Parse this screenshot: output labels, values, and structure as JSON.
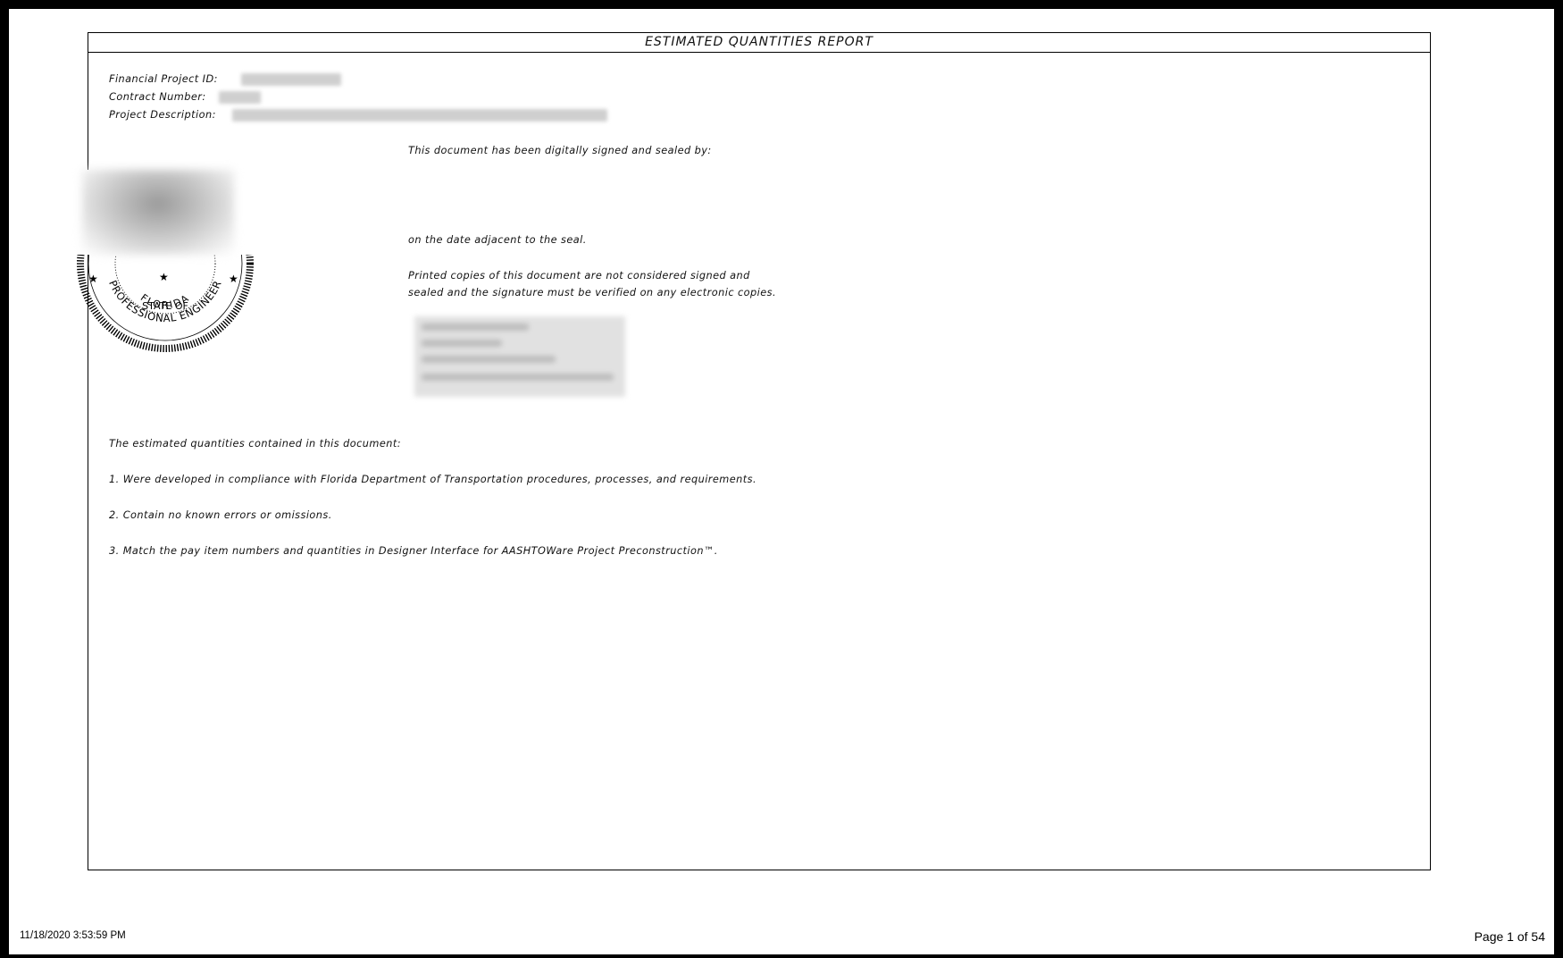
{
  "report": {
    "title": "ESTIMATED QUANTITIES REPORT",
    "financial_project_id_label": "Financial Project ID:",
    "contract_number_label": "Contract Number:",
    "project_description_label": "Project Description:",
    "signed_by_text": "This document has been digitally signed and sealed by:",
    "date_text": "on the date adjacent to the seal.",
    "printed_copies_line1": "Printed copies of this document are not considered signed and",
    "printed_copies_line2": "sealed and the signature must be verified on any electronic copies.",
    "intro": "The estimated quantities contained in this document:",
    "items": [
      "1. Were developed in compliance with Florida Department of Transportation procedures, processes, and requirements.",
      "2. Contain no known errors or omissions.",
      "3. Match the pay item numbers and quantities in Designer Interface for AASHTOWare Project Preconstruction™."
    ]
  },
  "seal": {
    "state_of": "STATE OF",
    "florida": "FLORIDA",
    "professional_engineer": "PROFESSIONAL ENGINEER"
  },
  "footer": {
    "timestamp": "11/18/2020 3:53:59 PM",
    "page": "Page 1 of 54"
  }
}
